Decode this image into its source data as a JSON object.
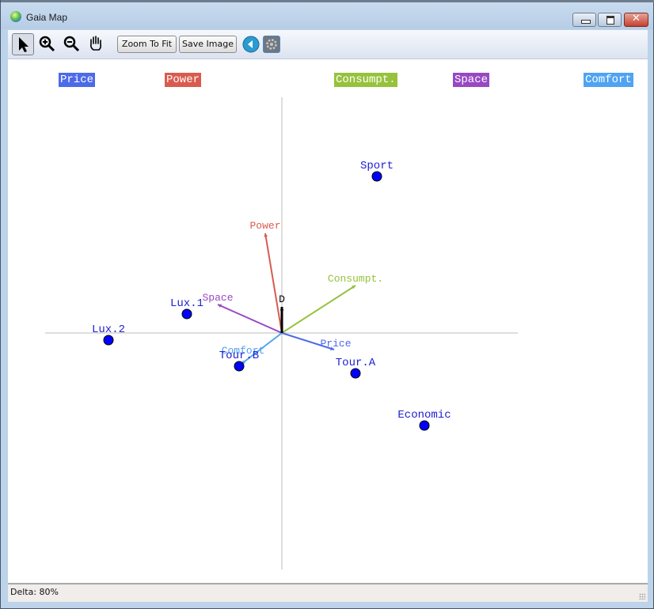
{
  "window": {
    "title": "Gaia Map"
  },
  "toolbar": {
    "tools": [
      "select",
      "zoom-in",
      "zoom-out",
      "pan"
    ],
    "zoom_to_fit_label": "Zoom To Fit",
    "save_image_label": "Save Image"
  },
  "legend": [
    {
      "label": "Price",
      "color": "#4d6ae8"
    },
    {
      "label": "Power",
      "color": "#d95b4f"
    },
    {
      "label": "Consumpt.",
      "color": "#96c23c"
    },
    {
      "label": "Space",
      "color": "#9848c3"
    },
    {
      "label": "Comfort",
      "color": "#4fa3f2"
    }
  ],
  "status": {
    "delta_text": "Delta: 80%"
  },
  "chart_data": {
    "type": "scatter",
    "title": "Gaia Map",
    "xlabel": "",
    "ylabel": "",
    "xlim": [
      -1.0,
      1.0
    ],
    "ylim": [
      -1.0,
      1.0
    ],
    "grid": false,
    "axes_through_origin": true,
    "legend_position": "top",
    "point_color": "#0000ff",
    "label_color": "#2020d0",
    "points": [
      {
        "label": "Sport",
        "x": 0.4,
        "y": 0.66
      },
      {
        "label": "Lux.1",
        "x": -0.4,
        "y": 0.08
      },
      {
        "label": "Lux.2",
        "x": -0.73,
        "y": -0.03
      },
      {
        "label": "Tour.B",
        "x": -0.18,
        "y": -0.14
      },
      {
        "label": "Tour.A",
        "x": 0.31,
        "y": -0.17
      },
      {
        "label": "Economic",
        "x": 0.6,
        "y": -0.39
      }
    ],
    "criteria_vectors": [
      {
        "label": "Power",
        "x": -0.07,
        "y": 0.42,
        "color": "#d95b4f"
      },
      {
        "label": "Consumpt.",
        "x": 0.31,
        "y": 0.2,
        "color": "#96c23c"
      },
      {
        "label": "Space",
        "x": -0.27,
        "y": 0.12,
        "color": "#9848c3"
      },
      {
        "label": "Price",
        "x": 0.22,
        "y": -0.07,
        "color": "#4d6ae8"
      },
      {
        "label": "Comfort",
        "x": -0.17,
        "y": -0.13,
        "color": "#4fa3f2"
      }
    ],
    "decision_axis": {
      "label": "D",
      "x": 0.0,
      "y": 0.11,
      "color": "#000000"
    }
  }
}
